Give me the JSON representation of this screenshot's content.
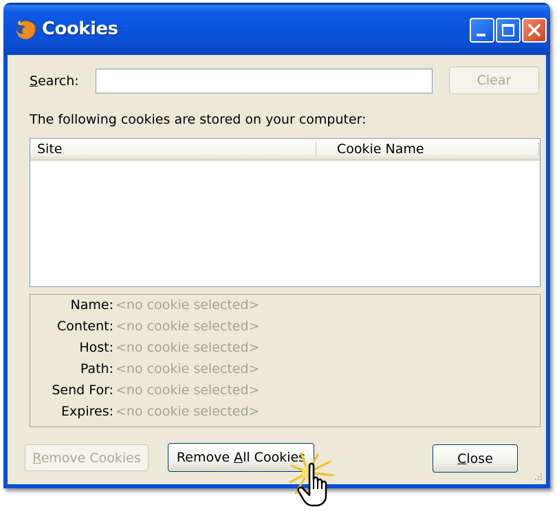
{
  "window": {
    "title": "Cookies",
    "icon": "firefox-icon"
  },
  "search": {
    "label_underlined": "S",
    "label_rest": "earch:",
    "value": "",
    "clear_label": "Clear"
  },
  "intro": "The following cookies are stored on your computer:",
  "tree": {
    "columns": [
      "Site",
      "Cookie Name"
    ],
    "rows": []
  },
  "details": [
    {
      "label": "Name:",
      "value": "<no cookie selected>"
    },
    {
      "label": "Content:",
      "value": "<no cookie selected>"
    },
    {
      "label": "Host:",
      "value": "<no cookie selected>"
    },
    {
      "label": "Path:",
      "value": "<no cookie selected>"
    },
    {
      "label": "Send For:",
      "value": "<no cookie selected>"
    },
    {
      "label": "Expires:",
      "value": "<no cookie selected>"
    }
  ],
  "buttons": {
    "remove_cookies": {
      "u": "R",
      "rest": "emove Cookies",
      "enabled": false
    },
    "remove_all": {
      "pre": "Remove ",
      "u": "A",
      "rest": "ll Cookies",
      "enabled": true
    },
    "close": {
      "u": "C",
      "rest": "lose",
      "enabled": true
    }
  },
  "colors": {
    "titlebar": "#0754dc",
    "client": "#ece9d8",
    "disabled_text": "#aca899"
  }
}
